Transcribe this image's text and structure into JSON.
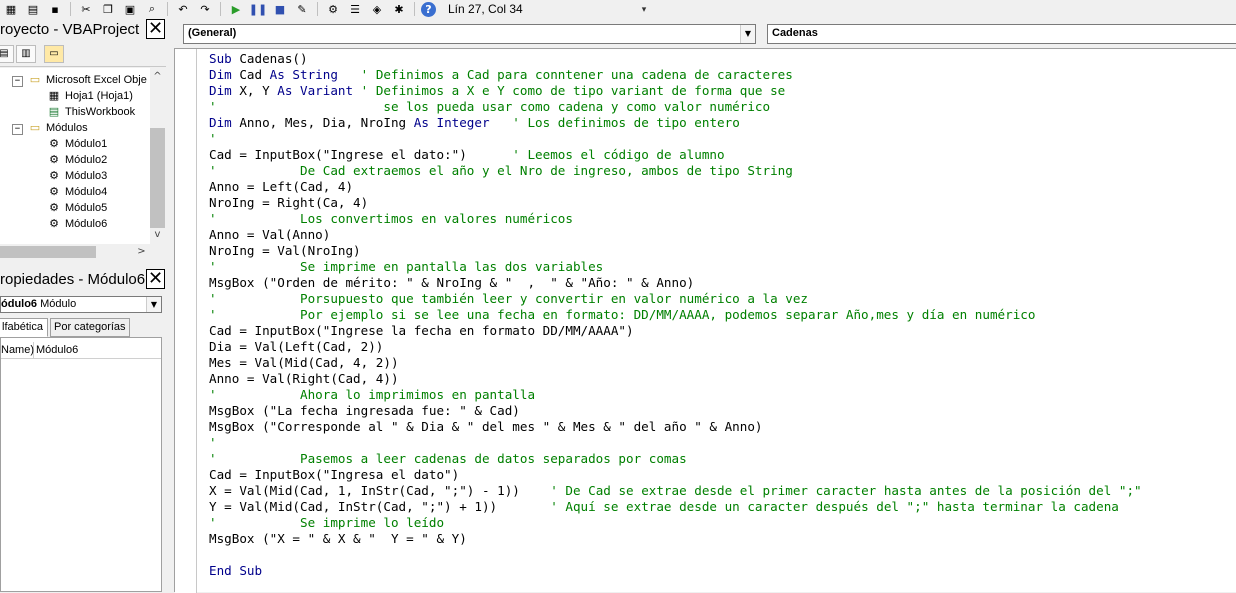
{
  "status": {
    "position": "Lín 27, Col 34"
  },
  "project": {
    "title": "royecto - VBAProject",
    "tree": [
      {
        "label": "Microsoft Excel Obje",
        "icon": "folder-icon"
      },
      {
        "label": "Hoja1 (Hoja1)",
        "icon": "sheet-icon"
      },
      {
        "label": "ThisWorkbook",
        "icon": "workbook-icon"
      },
      {
        "label": "Módulos",
        "icon": "folder-icon"
      },
      {
        "label": "Módulo1",
        "icon": "module-icon"
      },
      {
        "label": "Módulo2",
        "icon": "module-icon"
      },
      {
        "label": "Módulo3",
        "icon": "module-icon"
      },
      {
        "label": "Módulo4",
        "icon": "module-icon"
      },
      {
        "label": "Módulo5",
        "icon": "module-icon"
      },
      {
        "label": "Módulo6",
        "icon": "module-icon"
      }
    ]
  },
  "properties": {
    "title": "ropiedades - Módulo6",
    "object_name": "ódulo6",
    "object_type": "Módulo",
    "tabs": [
      "lfabética",
      "Por categorías"
    ],
    "rows": [
      {
        "name": "Name)",
        "value": "Módulo6"
      }
    ]
  },
  "code": {
    "object_combo": "(General)",
    "proc_combo": "Cadenas",
    "lines": [
      [
        {
          "t": "kw",
          "s": "Sub"
        },
        {
          "t": "tx",
          "s": " Cadenas()"
        }
      ],
      [
        {
          "t": "kw",
          "s": "Dim"
        },
        {
          "t": "tx",
          "s": " Cad "
        },
        {
          "t": "kw",
          "s": "As String"
        },
        {
          "t": "cm",
          "s": "   ' Definimos a Cad para conntener una cadena de caracteres"
        }
      ],
      [
        {
          "t": "kw",
          "s": "Dim"
        },
        {
          "t": "tx",
          "s": " X, Y "
        },
        {
          "t": "kw",
          "s": "As Variant"
        },
        {
          "t": "cm",
          "s": " ' Definimos a X e Y como de tipo variant de forma que se"
        }
      ],
      [
        {
          "t": "cm",
          "s": "'                      se los pueda usar como cadena y como valor numérico"
        }
      ],
      [
        {
          "t": "kw",
          "s": "Dim"
        },
        {
          "t": "tx",
          "s": " Anno, Mes, Dia, NroIng "
        },
        {
          "t": "kw",
          "s": "As Integer"
        },
        {
          "t": "cm",
          "s": "   ' Los definimos de tipo entero"
        }
      ],
      [
        {
          "t": "cm",
          "s": "'"
        }
      ],
      [
        {
          "t": "tx",
          "s": "Cad = InputBox(\"Ingrese el dato:\")      "
        },
        {
          "t": "cm",
          "s": "' Leemos el código de alumno"
        }
      ],
      [
        {
          "t": "cm",
          "s": "'           De Cad extraemos el año y el Nro de ingreso, ambos de tipo String"
        }
      ],
      [
        {
          "t": "tx",
          "s": "Anno = Left(Cad, 4)"
        }
      ],
      [
        {
          "t": "tx",
          "s": "NroIng = Right(Ca, 4)"
        }
      ],
      [
        {
          "t": "cm",
          "s": "'           Los convertimos en valores numéricos"
        }
      ],
      [
        {
          "t": "tx",
          "s": "Anno = Val(Anno)"
        }
      ],
      [
        {
          "t": "tx",
          "s": "NroIng = Val(NroIng)"
        }
      ],
      [
        {
          "t": "cm",
          "s": "'           Se imprime en pantalla las dos variables"
        }
      ],
      [
        {
          "t": "tx",
          "s": "MsgBox (\"Orden de mérito: \" & NroIng & \"  ,  \" & \"Año: \" & Anno)"
        }
      ],
      [
        {
          "t": "cm",
          "s": "'           Porsupuesto que también leer y convertir en valor numérico a la vez"
        }
      ],
      [
        {
          "t": "cm",
          "s": "'           Por ejemplo si se lee una fecha en formato: DD/MM/AAAA, podemos separar Año,mes y día en numérico"
        }
      ],
      [
        {
          "t": "tx",
          "s": "Cad = InputBox(\"Ingrese la fecha en formato DD/MM/AAAA\")"
        }
      ],
      [
        {
          "t": "tx",
          "s": "Dia = Val(Left(Cad, 2))"
        }
      ],
      [
        {
          "t": "tx",
          "s": "Mes = Val(Mid(Cad, 4, 2))"
        }
      ],
      [
        {
          "t": "tx",
          "s": "Anno = Val(Right(Cad, 4))"
        }
      ],
      [
        {
          "t": "cm",
          "s": "'           Ahora lo imprimimos en pantalla"
        }
      ],
      [
        {
          "t": "tx",
          "s": "MsgBox (\"La fecha ingresada fue: \" & Cad)"
        }
      ],
      [
        {
          "t": "tx",
          "s": "MsgBox (\"Corresponde al \" & Dia & \" del mes \" & Mes & \" del año \" & Anno)"
        }
      ],
      [
        {
          "t": "cm",
          "s": "'"
        }
      ],
      [
        {
          "t": "cm",
          "s": "'           Pasemos a leer cadenas de datos separados por comas"
        }
      ],
      [
        {
          "t": "tx",
          "s": "Cad = InputBox(\"Ingresa el dato\")"
        }
      ],
      [
        {
          "t": "tx",
          "s": "X = Val(Mid(Cad, 1, InStr(Cad, \";\") - 1))    "
        },
        {
          "t": "cm",
          "s": "' De Cad se extrae desde el primer caracter hasta antes de la posición del \";\""
        }
      ],
      [
        {
          "t": "tx",
          "s": "Y = Val(Mid(Cad, InStr(Cad, \";\") + 1))       "
        },
        {
          "t": "cm",
          "s": "' Aquí se extrae desde un caracter después del \";\" hasta terminar la cadena"
        }
      ],
      [
        {
          "t": "cm",
          "s": "'           Se imprime lo leído"
        }
      ],
      [
        {
          "t": "tx",
          "s": "MsgBox (\"X = \" & X & \"  Y = \" & Y)"
        }
      ],
      [
        {
          "t": "tx",
          "s": ""
        }
      ],
      [
        {
          "t": "kw",
          "s": "End Sub"
        }
      ]
    ]
  }
}
